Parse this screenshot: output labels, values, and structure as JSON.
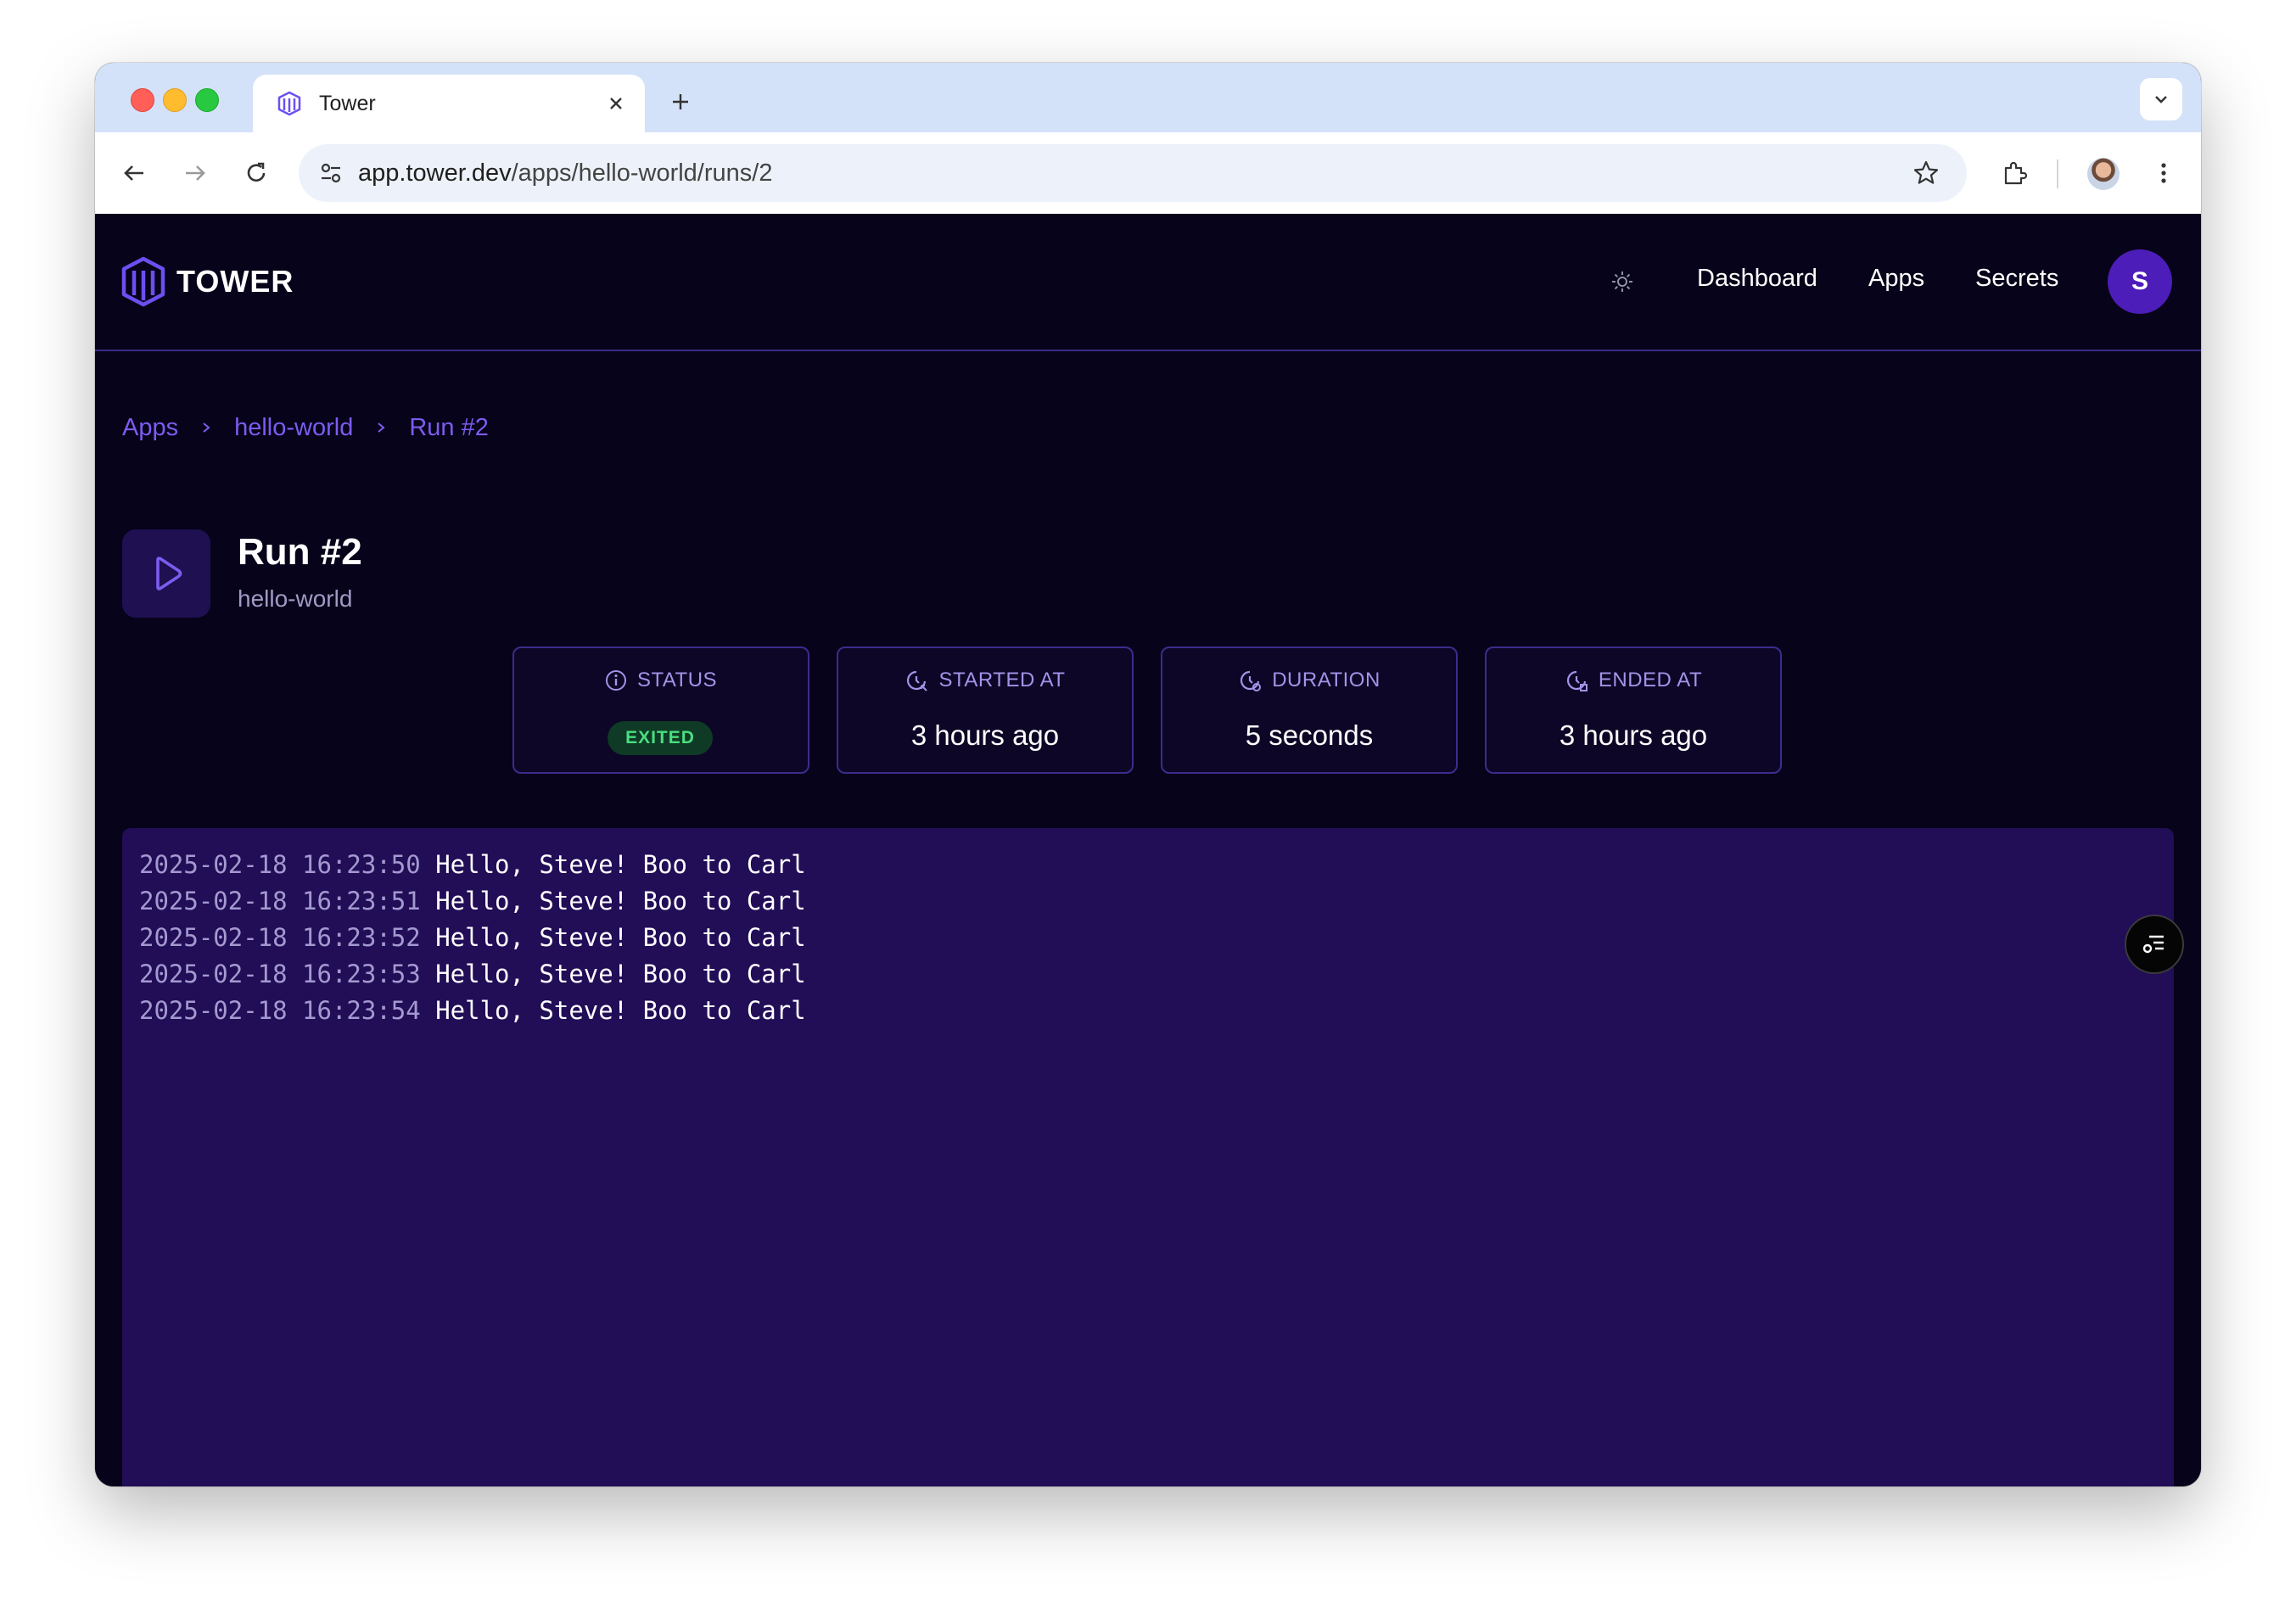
{
  "browser": {
    "tab": {
      "title": "Tower",
      "favicon": "tower-logo-icon"
    },
    "url": {
      "host": "app.tower.dev",
      "path": "/apps/hello-world/runs/2"
    }
  },
  "navbar": {
    "logo_text": "TOWER",
    "links": {
      "dashboard": "Dashboard",
      "apps": "Apps",
      "secrets": "Secrets"
    },
    "avatar_initial": "S"
  },
  "breadcrumb": {
    "items": [
      "Apps",
      "hello-world",
      "Run #2"
    ]
  },
  "run": {
    "title": "Run #2",
    "app_name": "hello-world"
  },
  "stats": {
    "status": {
      "label": "STATUS",
      "value": "EXITED"
    },
    "started_at": {
      "label": "STARTED AT",
      "value": "3 hours ago"
    },
    "duration": {
      "label": "DURATION",
      "value": "5 seconds"
    },
    "ended_at": {
      "label": "ENDED AT",
      "value": "3 hours ago"
    }
  },
  "logs": [
    {
      "ts": "2025-02-18 16:23:50",
      "msg": "Hello, Steve! Boo to Carl"
    },
    {
      "ts": "2025-02-18 16:23:51",
      "msg": "Hello, Steve! Boo to Carl"
    },
    {
      "ts": "2025-02-18 16:23:52",
      "msg": "Hello, Steve! Boo to Carl"
    },
    {
      "ts": "2025-02-18 16:23:53",
      "msg": "Hello, Steve! Boo to Carl"
    },
    {
      "ts": "2025-02-18 16:23:54",
      "msg": "Hello, Steve! Boo to Carl"
    }
  ],
  "colors": {
    "accent": "#7c5cf0",
    "background": "#07031a",
    "log_bg": "#220d57",
    "status_green": "#4ade80"
  }
}
